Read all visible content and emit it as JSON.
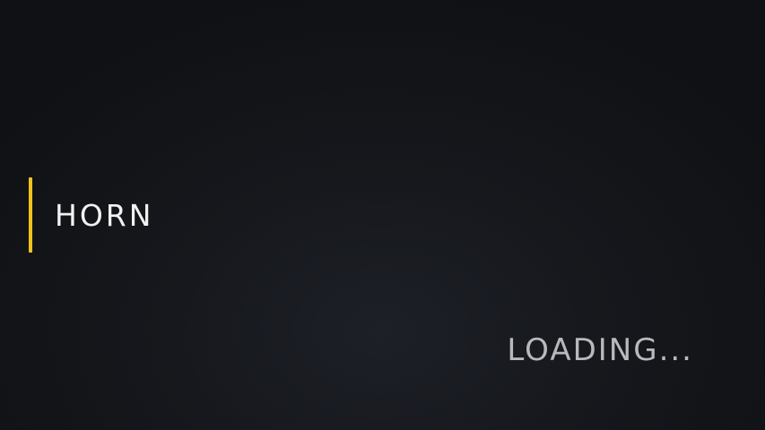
{
  "title": {
    "text": "HORN",
    "accent_color": "#f2c21b"
  },
  "status": {
    "loading_text": "LOADING..."
  }
}
